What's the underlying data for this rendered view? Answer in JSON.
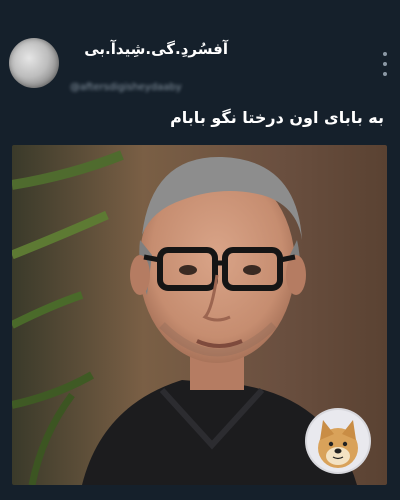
{
  "tweet": {
    "display_name": "آفسُردِ.گی.شِیدآ.بی",
    "username": "@aftersdigisheydaaby",
    "text": "به بابای اون درختا نگو بابام",
    "avatar_icon": "avatar-icon",
    "more_icon": "more-vertical-icon"
  },
  "media": {
    "type": "image",
    "description_icon": "photo-image"
  },
  "overlay": {
    "icon": "doge-sticker-icon"
  },
  "colors": {
    "background": "#15202b",
    "text": "#ffffff",
    "muted": "#8b98a5"
  }
}
